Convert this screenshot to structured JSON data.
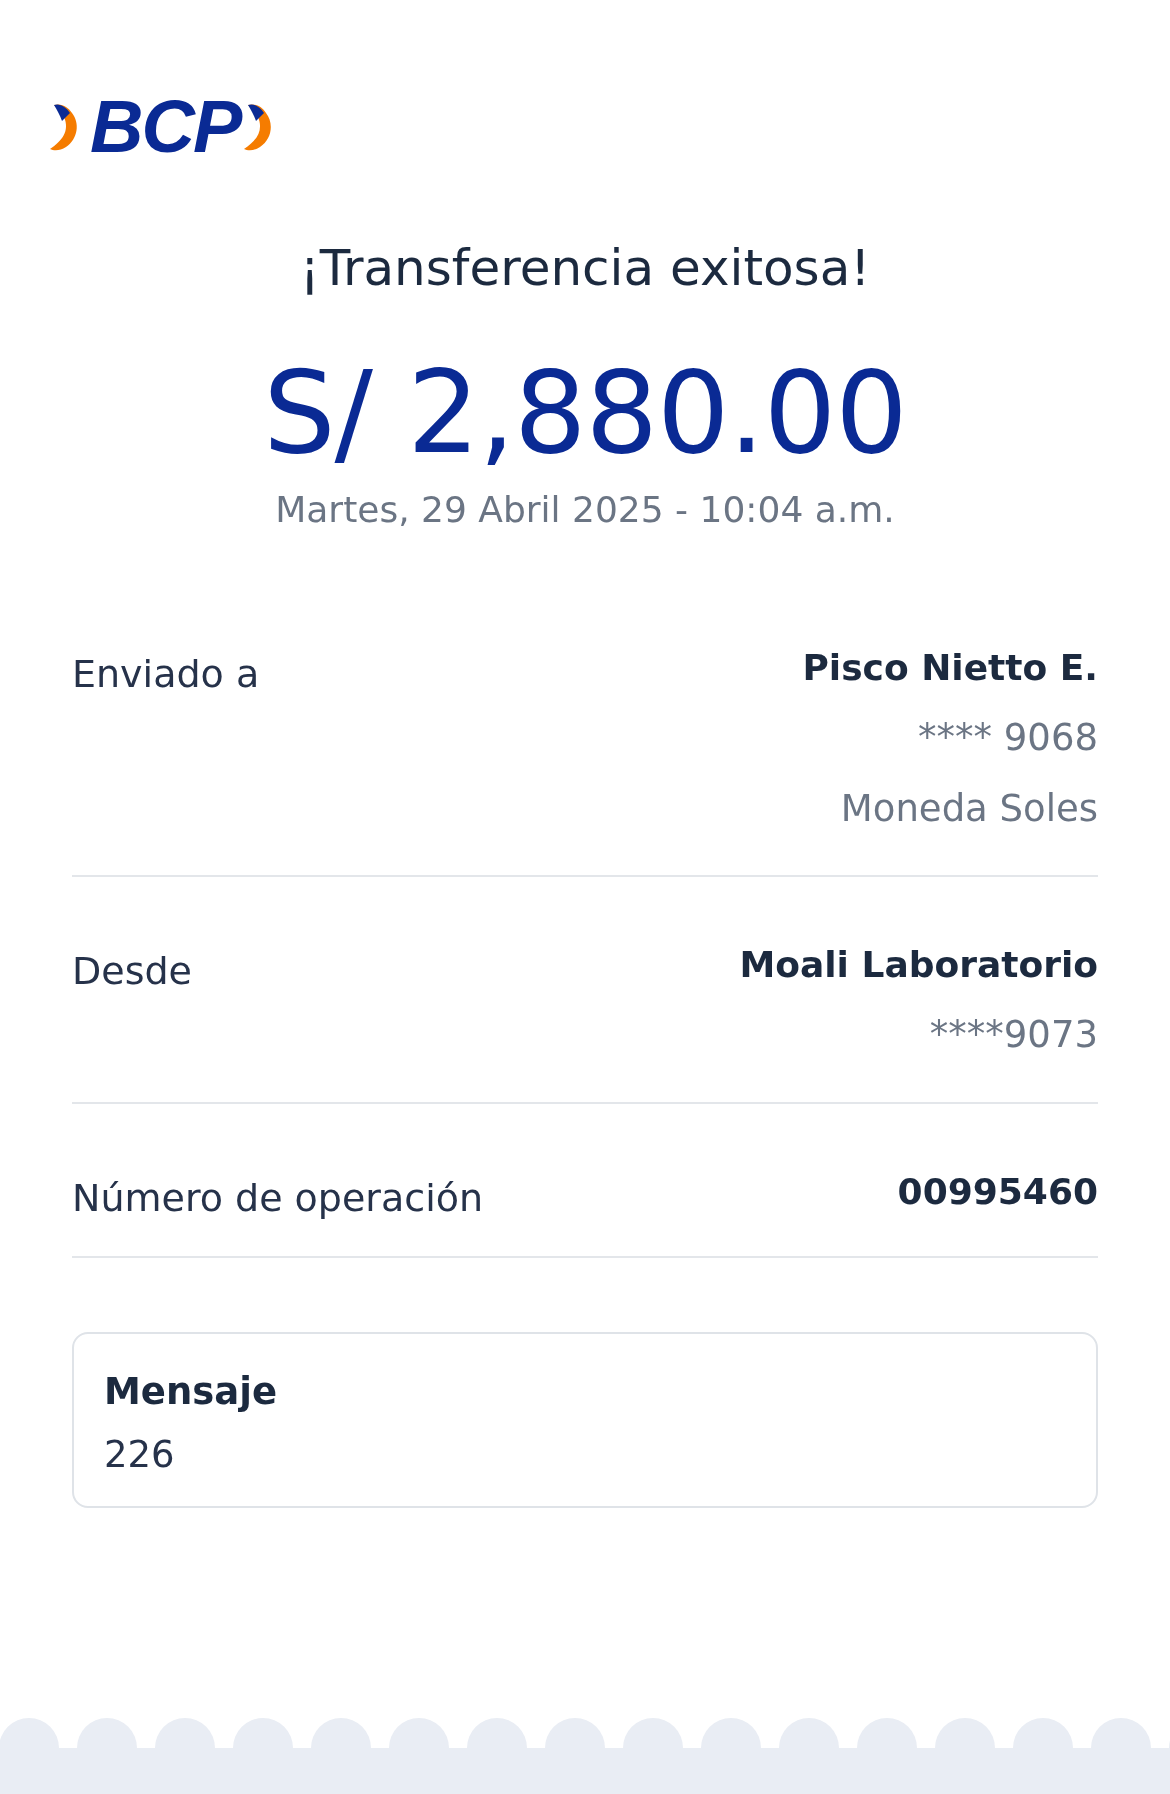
{
  "logo": {
    "text": "BCP"
  },
  "title": "¡Transferencia exitosa!",
  "amount": "S/ 2,880.00",
  "date": "Martes, 29 Abril 2025 - 10:04 a.m.",
  "details": [
    {
      "label": "Enviado a",
      "lines": [
        "Pisco Nietto E.",
        "**** 9068",
        "Moneda Soles"
      ]
    },
    {
      "label": "Desde",
      "lines": [
        "Moali Laboratorio",
        "****9073"
      ]
    },
    {
      "label": "Número de operación",
      "lines": [
        "00995460"
      ]
    }
  ],
  "message": {
    "label": "Mensaje",
    "value": "226"
  }
}
